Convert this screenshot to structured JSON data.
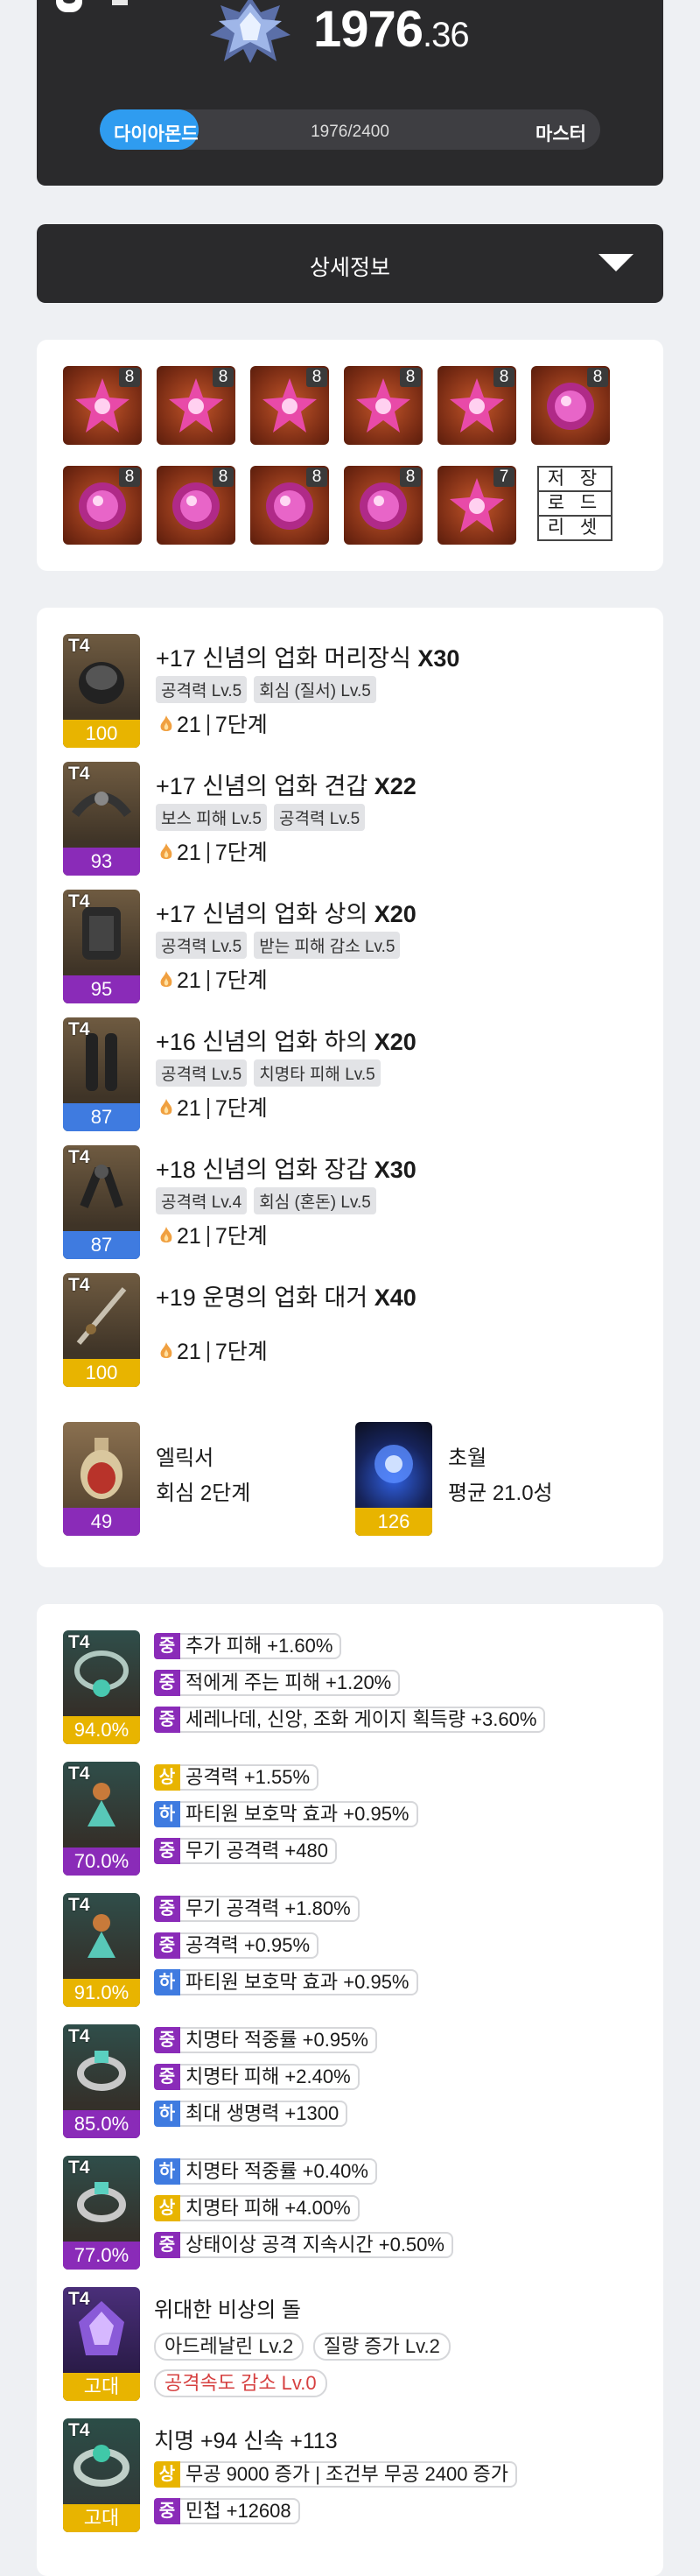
{
  "header": {
    "score_int": "1976",
    "score_dec": ".36",
    "tier_left": "다이아몬드",
    "tier_progress_text": "1976/2400",
    "tier_right": "마스터",
    "tier_progress_fraction": 0.0,
    "emblem_icon": "diamond-tier-emblem-icon"
  },
  "details": {
    "label": "상세정보",
    "icon": "caret-down-icon"
  },
  "gems": {
    "row1": [
      {
        "level": "8",
        "kind": "red-star"
      },
      {
        "level": "8",
        "kind": "red-star"
      },
      {
        "level": "8",
        "kind": "red-star"
      },
      {
        "level": "8",
        "kind": "red-star"
      },
      {
        "level": "8",
        "kind": "red-star"
      },
      {
        "level": "8",
        "kind": "pink-orb"
      }
    ],
    "row2": [
      {
        "level": "8",
        "kind": "pink-orb"
      },
      {
        "level": "8",
        "kind": "pink-orb"
      },
      {
        "level": "8",
        "kind": "pink-orb"
      },
      {
        "level": "8",
        "kind": "pink-orb"
      },
      {
        "level": "7",
        "kind": "red-star"
      }
    ],
    "preset": [
      "저 장",
      "로 드",
      "리 셋"
    ]
  },
  "equipment": [
    {
      "tier": "T4",
      "quality": "100",
      "qcolor": "gold",
      "title": "+17 신념의 업화 머리장식 ",
      "mult": "X30",
      "tags": [
        "공격력 Lv.5",
        "회심 (질서) Lv.5"
      ],
      "level": "21",
      "stage": "7단계"
    },
    {
      "tier": "T4",
      "quality": "93",
      "qcolor": "purple",
      "title": "+17 신념의 업화 견갑 ",
      "mult": "X22",
      "tags": [
        "보스 피해 Lv.5",
        "공격력 Lv.5"
      ],
      "level": "21",
      "stage": "7단계"
    },
    {
      "tier": "T4",
      "quality": "95",
      "qcolor": "purple",
      "title": "+17 신념의 업화 상의 ",
      "mult": "X20",
      "tags": [
        "공격력 Lv.5",
        "받는 피해 감소 Lv.5"
      ],
      "level": "21",
      "stage": "7단계"
    },
    {
      "tier": "T4",
      "quality": "87",
      "qcolor": "blue",
      "title": "+16 신념의 업화 하의 ",
      "mult": "X20",
      "tags": [
        "공격력 Lv.5",
        "치명타 피해 Lv.5"
      ],
      "level": "21",
      "stage": "7단계"
    },
    {
      "tier": "T4",
      "quality": "87",
      "qcolor": "blue",
      "title": "+18 신념의 업화 장갑 ",
      "mult": "X30",
      "tags": [
        "공격력 Lv.4",
        "회심 (혼돈) Lv.5"
      ],
      "level": "21",
      "stage": "7단계"
    },
    {
      "tier": "T4",
      "quality": "100",
      "qcolor": "gold",
      "title": "+19 운명의 업화 대거 ",
      "mult": "X40",
      "tags": [],
      "level": "21",
      "stage": "7단계"
    }
  ],
  "elixir": {
    "quality": "49",
    "name": "엘릭서",
    "value": "회심 2단계"
  },
  "transcend": {
    "quality": "126",
    "name": "초월",
    "value": "평균 21.0성"
  },
  "accessories": [
    {
      "tier": "T4",
      "quality": "94.0%",
      "qcolor": "gold",
      "opts": [
        [
          "중",
          "추가 피해 +1.60%"
        ],
        [
          "중",
          "적에게 주는 피해 +1.20%"
        ],
        [
          "중",
          "세레나데, 신앙, 조화 게이지 획득량 +3.60%"
        ]
      ]
    },
    {
      "tier": "T4",
      "quality": "70.0%",
      "qcolor": "purple",
      "opts": [
        [
          "상",
          "공격력 +1.55%"
        ],
        [
          "하",
          "파티원 보호막 효과 +0.95%"
        ],
        [
          "중",
          "무기 공격력 +480"
        ]
      ]
    },
    {
      "tier": "T4",
      "quality": "91.0%",
      "qcolor": "gold",
      "opts": [
        [
          "중",
          "무기 공격력 +1.80%"
        ],
        [
          "중",
          "공격력 +0.95%"
        ],
        [
          "하",
          "파티원 보호막 효과 +0.95%"
        ]
      ]
    },
    {
      "tier": "T4",
      "quality": "85.0%",
      "qcolor": "purple",
      "opts": [
        [
          "중",
          "치명타 적중률 +0.95%"
        ],
        [
          "중",
          "치명타 피해 +2.40%"
        ],
        [
          "하",
          "최대 생명력 +1300"
        ]
      ]
    },
    {
      "tier": "T4",
      "quality": "77.0%",
      "qcolor": "purple",
      "opts": [
        [
          "하",
          "치명타 적중률 +0.40%"
        ],
        [
          "상",
          "치명타 피해 +4.00%"
        ],
        [
          "중",
          "상태이상 공격 지속시간 +0.50%"
        ]
      ]
    }
  ],
  "stone": {
    "tier": "T4",
    "quality": "고대",
    "name": "위대한 비상의 돌",
    "pills": [
      "아드레날린 Lv.2",
      "질량 증가 Lv.2"
    ],
    "neg": "공격속도 감소 Lv.0"
  },
  "bracelet": {
    "tier": "T4",
    "quality": "고대",
    "title": "치명 +94 신속 +113",
    "opts": [
      [
        "상",
        "무공 9000 증가 | 조건부 무공 2400 증가"
      ],
      [
        "중",
        "민첩 +12608"
      ]
    ]
  }
}
